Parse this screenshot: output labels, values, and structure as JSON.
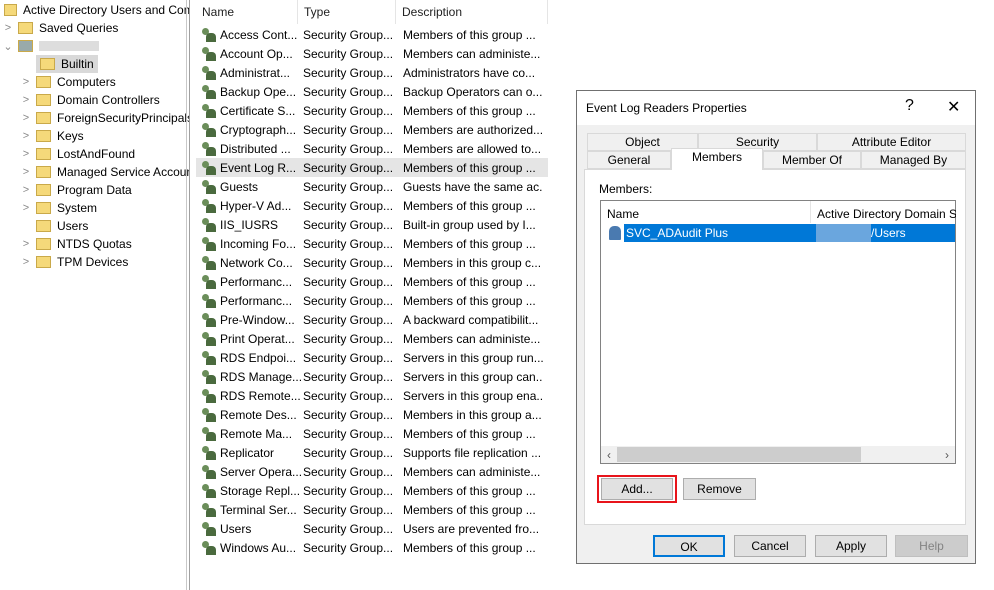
{
  "tree": {
    "root": "Active Directory Users and Computers",
    "items": [
      {
        "label": "Saved Queries"
      },
      {
        "label": "Builtin"
      },
      {
        "label": "Computers"
      },
      {
        "label": "Domain Controllers"
      },
      {
        "label": "ForeignSecurityPrincipals"
      },
      {
        "label": "Keys"
      },
      {
        "label": "LostAndFound"
      },
      {
        "label": "Managed Service Accounts"
      },
      {
        "label": "Program Data"
      },
      {
        "label": "System"
      },
      {
        "label": "Users"
      },
      {
        "label": "NTDS Quotas"
      },
      {
        "label": "TPM Devices"
      }
    ]
  },
  "list": {
    "headers": [
      "Name",
      "Type",
      "Description"
    ],
    "rows": [
      [
        "Access Cont...",
        "Security Group...",
        "Members of this group ..."
      ],
      [
        "Account Op...",
        "Security Group...",
        "Members can administe..."
      ],
      [
        "Administrat...",
        "Security Group...",
        "Administrators have co..."
      ],
      [
        "Backup Ope...",
        "Security Group...",
        "Backup Operators can o..."
      ],
      [
        "Certificate S...",
        "Security Group...",
        "Members of this group ..."
      ],
      [
        "Cryptograph...",
        "Security Group...",
        "Members are authorized..."
      ],
      [
        "Distributed ...",
        "Security Group...",
        "Members are allowed to..."
      ],
      [
        "Event Log R...",
        "Security Group...",
        "Members of this group ..."
      ],
      [
        "Guests",
        "Security Group...",
        "Guests have the same ac..."
      ],
      [
        "Hyper-V Ad...",
        "Security Group...",
        "Members of this group ..."
      ],
      [
        "IIS_IUSRS",
        "Security Group...",
        "Built-in group used by I..."
      ],
      [
        "Incoming Fo...",
        "Security Group...",
        "Members of this group ..."
      ],
      [
        "Network Co...",
        "Security Group...",
        "Members in this group c..."
      ],
      [
        "Performanc...",
        "Security Group...",
        "Members of this group ..."
      ],
      [
        "Performanc...",
        "Security Group...",
        "Members of this group ..."
      ],
      [
        "Pre-Window...",
        "Security Group...",
        "A backward compatibilit..."
      ],
      [
        "Print Operat...",
        "Security Group...",
        "Members can administe..."
      ],
      [
        "RDS Endpoi...",
        "Security Group...",
        "Servers in this group run..."
      ],
      [
        "RDS Manage...",
        "Security Group...",
        "Servers in this group can..."
      ],
      [
        "RDS Remote...",
        "Security Group...",
        "Servers in this group ena..."
      ],
      [
        "Remote Des...",
        "Security Group...",
        "Members in this group a..."
      ],
      [
        "Remote Ma...",
        "Security Group...",
        "Members of this group ..."
      ],
      [
        "Replicator",
        "Security Group...",
        "Supports file replication ..."
      ],
      [
        "Server Opera...",
        "Security Group...",
        "Members can administe..."
      ],
      [
        "Storage Repl...",
        "Security Group...",
        "Members of this group ..."
      ],
      [
        "Terminal Ser...",
        "Security Group...",
        "Members of this group ..."
      ],
      [
        "Users",
        "Security Group...",
        "Users are prevented fro..."
      ],
      [
        "Windows Au...",
        "Security Group...",
        "Members of this group ..."
      ]
    ]
  },
  "dialog": {
    "title": "Event Log Readers Properties",
    "help": "?",
    "close": "✕",
    "tabs_back": [
      "Object",
      "Security",
      "Attribute Editor"
    ],
    "tabs_front": [
      "General",
      "Members",
      "Member Of",
      "Managed By"
    ],
    "members_label": "Members:",
    "columns": [
      "Name",
      "Active Directory Domain Serv"
    ],
    "members": [
      {
        "name": "SVC_ADAudit Plus",
        "folder": "/Users"
      }
    ],
    "add": "Add...",
    "remove": "Remove",
    "ok": "OK",
    "cancel": "Cancel",
    "apply": "Apply",
    "helpbtn": "Help"
  }
}
